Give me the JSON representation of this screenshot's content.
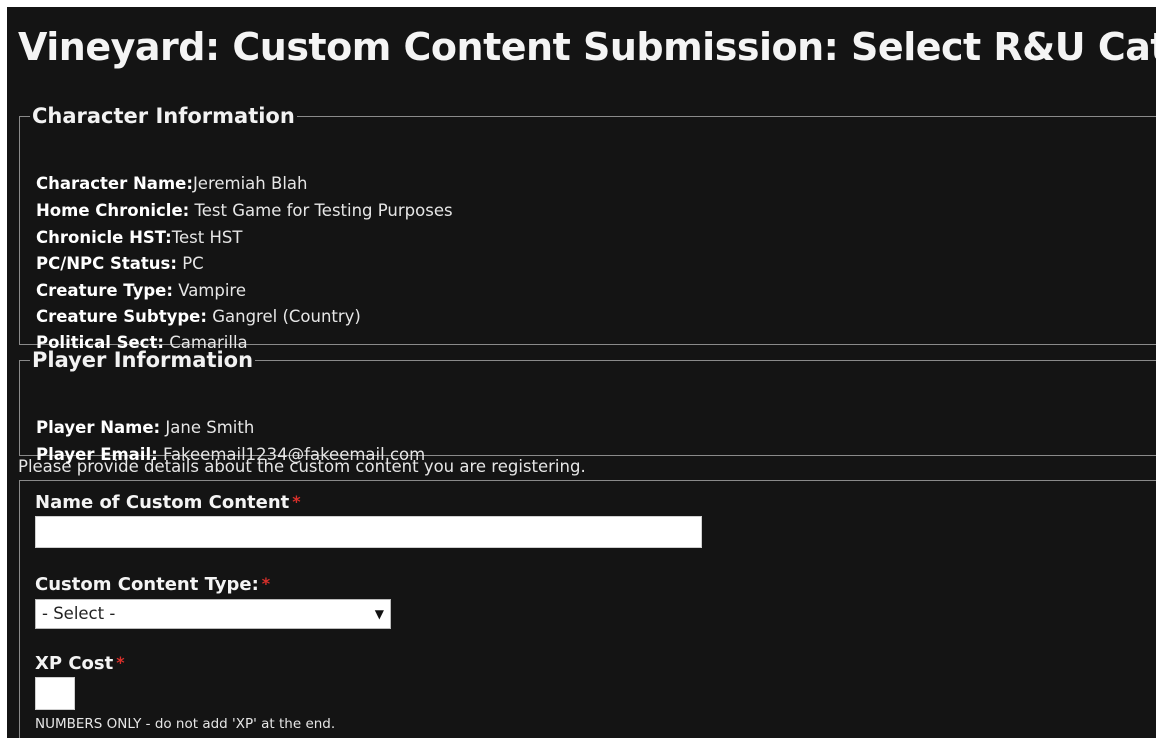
{
  "page": {
    "title": "Vineyard: Custom Content Submission: Select R&U Category"
  },
  "character_info": {
    "legend": "Character Information",
    "rows": [
      {
        "label": "Character Name:",
        "value": "Jeremiah Blah"
      },
      {
        "label": "Home Chronicle:",
        "value": "Test Game for Testing Purposes"
      },
      {
        "label": "Chronicle HST:",
        "value": "Test HST"
      },
      {
        "label": "PC/NPC Status:",
        "value": "PC"
      },
      {
        "label": "Creature Type:",
        "value": "Vampire"
      },
      {
        "label": "Creature Subtype:",
        "value": "Gangrel (Country)"
      },
      {
        "label": "Political Sect:",
        "value": "Camarilla"
      }
    ]
  },
  "player_info": {
    "legend": "Player Information",
    "rows": [
      {
        "label": "Player Name:",
        "value": "Jane Smith"
      },
      {
        "label": "Player Email:",
        "value": "Fakeemail1234@fakeemail.com"
      }
    ]
  },
  "form": {
    "intro": "Please provide details about the custom content you are registering.",
    "required_marker": "*",
    "name_field": {
      "label": "Name of Custom Content",
      "value": ""
    },
    "type_field": {
      "label": "Custom Content Type:",
      "selected": "- Select -",
      "chevron": "▼"
    },
    "xp_field": {
      "label": "XP Cost",
      "value": "",
      "help": "NUMBERS ONLY - do not add 'XP' at the end."
    }
  },
  "colors": {
    "background": "#141414",
    "required": "#d9302b",
    "border": "#8a8a8a"
  }
}
